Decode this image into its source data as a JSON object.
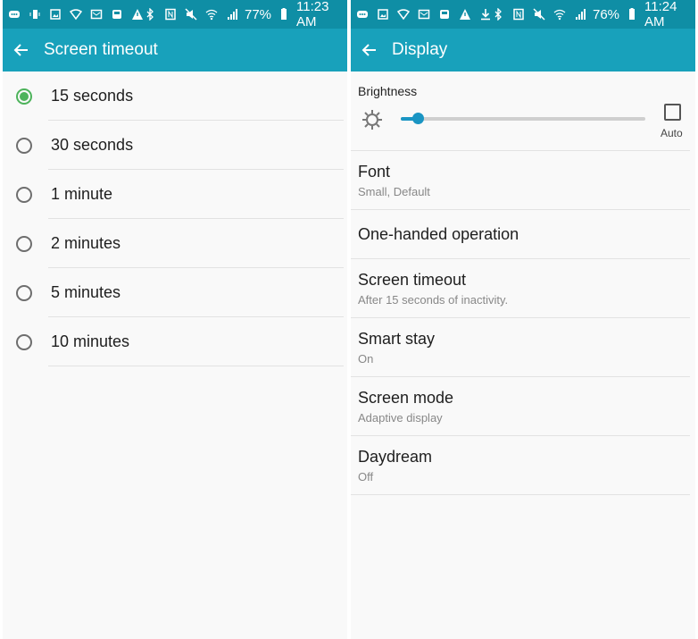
{
  "left": {
    "statusbar": {
      "notification_icons": [
        "messenger-icon",
        "vibrate-icon",
        "gallery-icon",
        "wifi-notice-icon",
        "email-icon",
        "inbox-icon",
        "warning-icon"
      ],
      "system_icons": [
        "bluetooth-icon",
        "nfc-icon",
        "mute-icon",
        "wifi-icon",
        "signal-icon"
      ],
      "battery": "77%",
      "time": "11:23 AM"
    },
    "appbar": {
      "title": "Screen timeout"
    },
    "options": [
      {
        "label": "15 seconds",
        "selected": true
      },
      {
        "label": "30 seconds",
        "selected": false
      },
      {
        "label": "1 minute",
        "selected": false
      },
      {
        "label": "2 minutes",
        "selected": false
      },
      {
        "label": "5 minutes",
        "selected": false
      },
      {
        "label": "10 minutes",
        "selected": false
      }
    ]
  },
  "right": {
    "statusbar": {
      "notification_icons": [
        "messenger-icon",
        "gallery-icon",
        "wifi-notice-icon",
        "email-icon",
        "inbox-icon",
        "warning-icon",
        "download-icon"
      ],
      "system_icons": [
        "bluetooth-icon",
        "nfc-icon",
        "mute-icon",
        "wifi-icon",
        "signal-icon"
      ],
      "battery": "76%",
      "time": "11:24 AM"
    },
    "appbar": {
      "title": "Display"
    },
    "brightness": {
      "label": "Brightness",
      "level_percent": 7,
      "auto_label": "Auto",
      "auto_checked": false
    },
    "items": [
      {
        "title": "Font",
        "subtitle": "Small, Default"
      },
      {
        "title": "One-handed operation",
        "subtitle": ""
      },
      {
        "title": "Screen timeout",
        "subtitle": "After 15 seconds of inactivity."
      },
      {
        "title": "Smart stay",
        "subtitle": "On"
      },
      {
        "title": "Screen mode",
        "subtitle": "Adaptive display"
      },
      {
        "title": "Daydream",
        "subtitle": "Off"
      }
    ]
  },
  "colors": {
    "statusbar": "#0f8ea5",
    "appbar": "#18a1bb",
    "radio_selected": "#4db35b",
    "slider": "#1a95c3"
  }
}
